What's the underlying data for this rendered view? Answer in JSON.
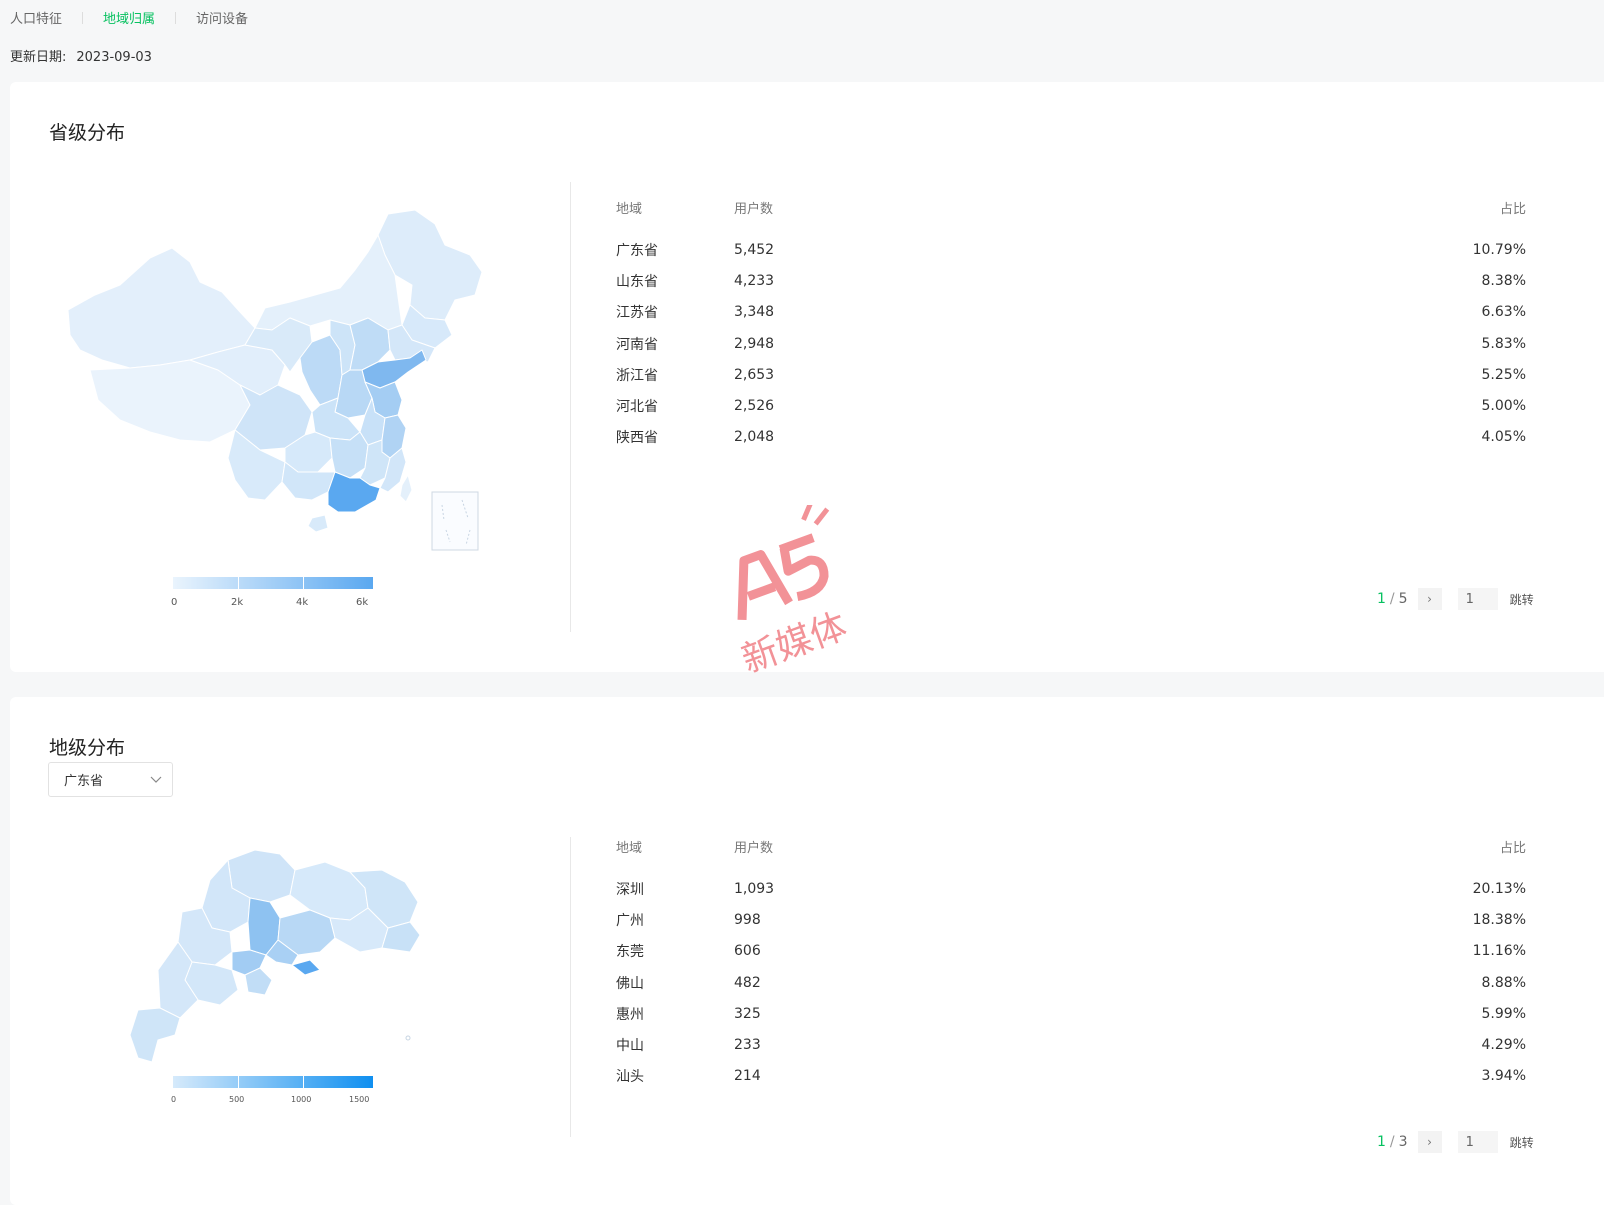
{
  "tabs": [
    {
      "label": "人口特征",
      "active": false
    },
    {
      "label": "地域归属",
      "active": true
    },
    {
      "label": "访问设备",
      "active": false
    }
  ],
  "update": {
    "label": "更新日期:",
    "value": "2023-09-03"
  },
  "province_section": {
    "title": "省级分布",
    "legend": {
      "labels": [
        "0",
        "2k",
        "4k",
        "6k"
      ],
      "colors": [
        "#eaf4fd",
        "#5aa8f0"
      ]
    },
    "table": {
      "headers": {
        "region": "地域",
        "users": "用户数",
        "ratio": "占比"
      },
      "rows": [
        {
          "region": "广东省",
          "users": "5,452",
          "ratio": "10.79%"
        },
        {
          "region": "山东省",
          "users": "4,233",
          "ratio": "8.38%"
        },
        {
          "region": "江苏省",
          "users": "3,348",
          "ratio": "6.63%"
        },
        {
          "region": "河南省",
          "users": "2,948",
          "ratio": "5.83%"
        },
        {
          "region": "浙江省",
          "users": "2,653",
          "ratio": "5.25%"
        },
        {
          "region": "河北省",
          "users": "2,526",
          "ratio": "5.00%"
        },
        {
          "region": "陕西省",
          "users": "2,048",
          "ratio": "4.05%"
        }
      ]
    },
    "pager": {
      "current": "1",
      "total": "5",
      "input": "1",
      "jump": "跳转"
    }
  },
  "city_section": {
    "title": "地级分布",
    "select_value": "广东省",
    "legend": {
      "labels": [
        "0",
        "500",
        "1000",
        "1500"
      ],
      "colors": [
        "#d6eafb",
        "#0f8ff0"
      ]
    },
    "table": {
      "headers": {
        "region": "地域",
        "users": "用户数",
        "ratio": "占比"
      },
      "rows": [
        {
          "region": "深圳",
          "users": "1,093",
          "ratio": "20.13%"
        },
        {
          "region": "广州",
          "users": "998",
          "ratio": "18.38%"
        },
        {
          "region": "东莞",
          "users": "606",
          "ratio": "11.16%"
        },
        {
          "region": "佛山",
          "users": "482",
          "ratio": "8.88%"
        },
        {
          "region": "惠州",
          "users": "325",
          "ratio": "5.99%"
        },
        {
          "region": "中山",
          "users": "233",
          "ratio": "4.29%"
        },
        {
          "region": "汕头",
          "users": "214",
          "ratio": "3.94%"
        }
      ]
    },
    "pager": {
      "current": "1",
      "total": "3",
      "input": "1",
      "jump": "跳转"
    }
  },
  "watermark": {
    "text": "新媒体",
    "accent": "#f07f86"
  },
  "colors": {
    "accent": "#07c160"
  }
}
